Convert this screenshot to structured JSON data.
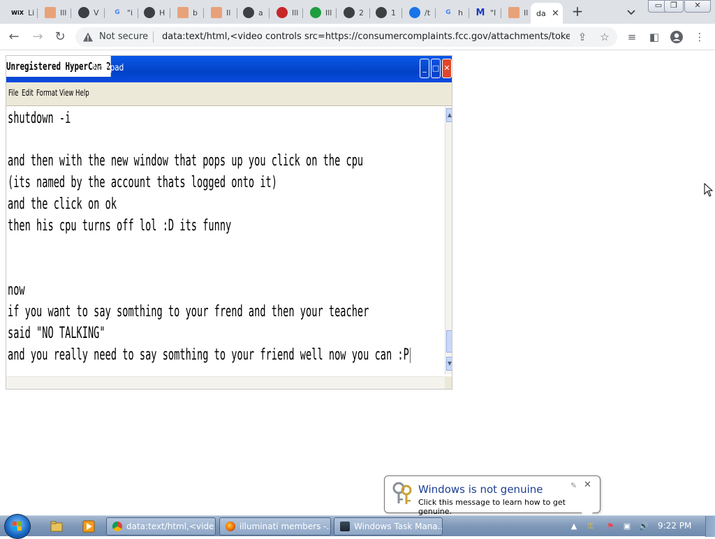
{
  "browser": {
    "tabs": [
      {
        "favicon_text": "WiX",
        "favicon_color": "#000000",
        "title": "Li",
        "icon": "wix-icon"
      },
      {
        "favicon_text": "",
        "favicon_color": "#e8a27a",
        "title": "Ill",
        "icon": "pyramid-icon"
      },
      {
        "favicon_text": "",
        "favicon_color": "#3c4043",
        "title": "V",
        "icon": "globe-icon"
      },
      {
        "favicon_text": "G",
        "favicon_color": "#4285f4",
        "title": "\"i",
        "icon": "google-icon"
      },
      {
        "favicon_text": "",
        "favicon_color": "#3c4043",
        "title": "H",
        "icon": "globe-icon"
      },
      {
        "favicon_text": "",
        "favicon_color": "#e8a27a",
        "title": "b",
        "icon": "pyramid-icon"
      },
      {
        "favicon_text": "",
        "favicon_color": "#e8a27a",
        "title": "Il",
        "icon": "pyramid-icon"
      },
      {
        "favicon_text": "",
        "favicon_color": "#3c4043",
        "title": "a",
        "icon": "globe-icon"
      },
      {
        "favicon_text": "",
        "favicon_color": "#c62828",
        "title": "Ill",
        "icon": "avatar-icon"
      },
      {
        "favicon_text": "",
        "favicon_color": "#1e9e3e",
        "title": "Ill",
        "icon": "check-circle-icon"
      },
      {
        "favicon_text": "",
        "favicon_color": "#3c4043",
        "title": "2",
        "icon": "globe-icon"
      },
      {
        "favicon_text": "",
        "favicon_color": "#3c4043",
        "title": "1",
        "icon": "globe-icon"
      },
      {
        "favicon_text": "",
        "favicon_color": "#1a73e8",
        "title": "/t",
        "icon": "cloud-upload-icon"
      },
      {
        "favicon_text": "G",
        "favicon_color": "#4285f4",
        "title": "h",
        "icon": "google-icon"
      },
      {
        "favicon_text": "M",
        "favicon_color": "#1a3cbf",
        "title": "\"I",
        "icon": "malwarebytes-icon"
      },
      {
        "favicon_text": "",
        "favicon_color": "#e8a27a",
        "title": "Il",
        "icon": "pyramid-icon"
      },
      {
        "favicon_text": "",
        "favicon_color": "#ffffff",
        "title": "da",
        "icon": "blank-page-icon",
        "active": true
      }
    ],
    "security_label": "Not secure",
    "url": "data:text/html,<video controls src=https://consumercomplaints.fcc.gov/attachments/token/c..."
  },
  "notepad": {
    "overlay_watermark": "Unregistered HyperCam 2",
    "title": "Notepad",
    "menu": [
      "File",
      "Edit",
      "Format",
      "View",
      "Help"
    ],
    "lines": [
      "shutdown -i",
      "",
      "and then with the new window that pops up you click on the cpu",
      "(its named by the account thats logged onto it)",
      "and the click on ok",
      "then his cpu turns off lol :D its funny",
      "",
      "",
      "now",
      "if you want to say somthing to your frend and then your teacher",
      "said \"NO TALKING\"",
      "and you really need to say somthing to your friend well now you can :P"
    ]
  },
  "balloon": {
    "title": "Windows is not genuine",
    "message": "Click this message to learn how to get genuine."
  },
  "taskbar": {
    "buttons": [
      {
        "label": "data:text/html,<vide...",
        "icon": "chrome-icon"
      },
      {
        "label": "illuminati members -...",
        "icon": "firefox-icon"
      },
      {
        "label": "Windows Task Mana...",
        "icon": "task-manager-icon"
      }
    ],
    "clock": "9:22 PM"
  }
}
